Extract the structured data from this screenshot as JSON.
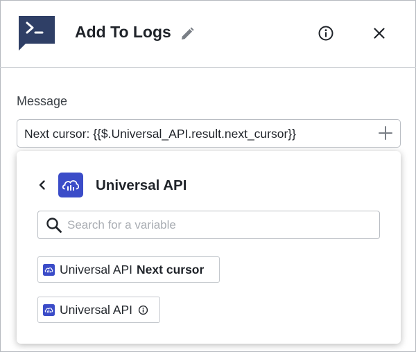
{
  "header": {
    "title": "Add To Logs",
    "icons": [
      "terminal-icon",
      "pencil-icon",
      "info-icon",
      "close-icon"
    ]
  },
  "message": {
    "label": "Message",
    "value": "Next cursor: {{$.Universal_API.result.next_cursor}}"
  },
  "dropdown": {
    "title": "Universal API",
    "search_placeholder": "Search for a variable",
    "options": [
      {
        "label": "Universal API",
        "bold": "Next cursor"
      },
      {
        "label": "Universal API"
      }
    ]
  },
  "colors": {
    "brand_blue": "#3b4cc8",
    "terminal_navy": "#2f3f66"
  }
}
